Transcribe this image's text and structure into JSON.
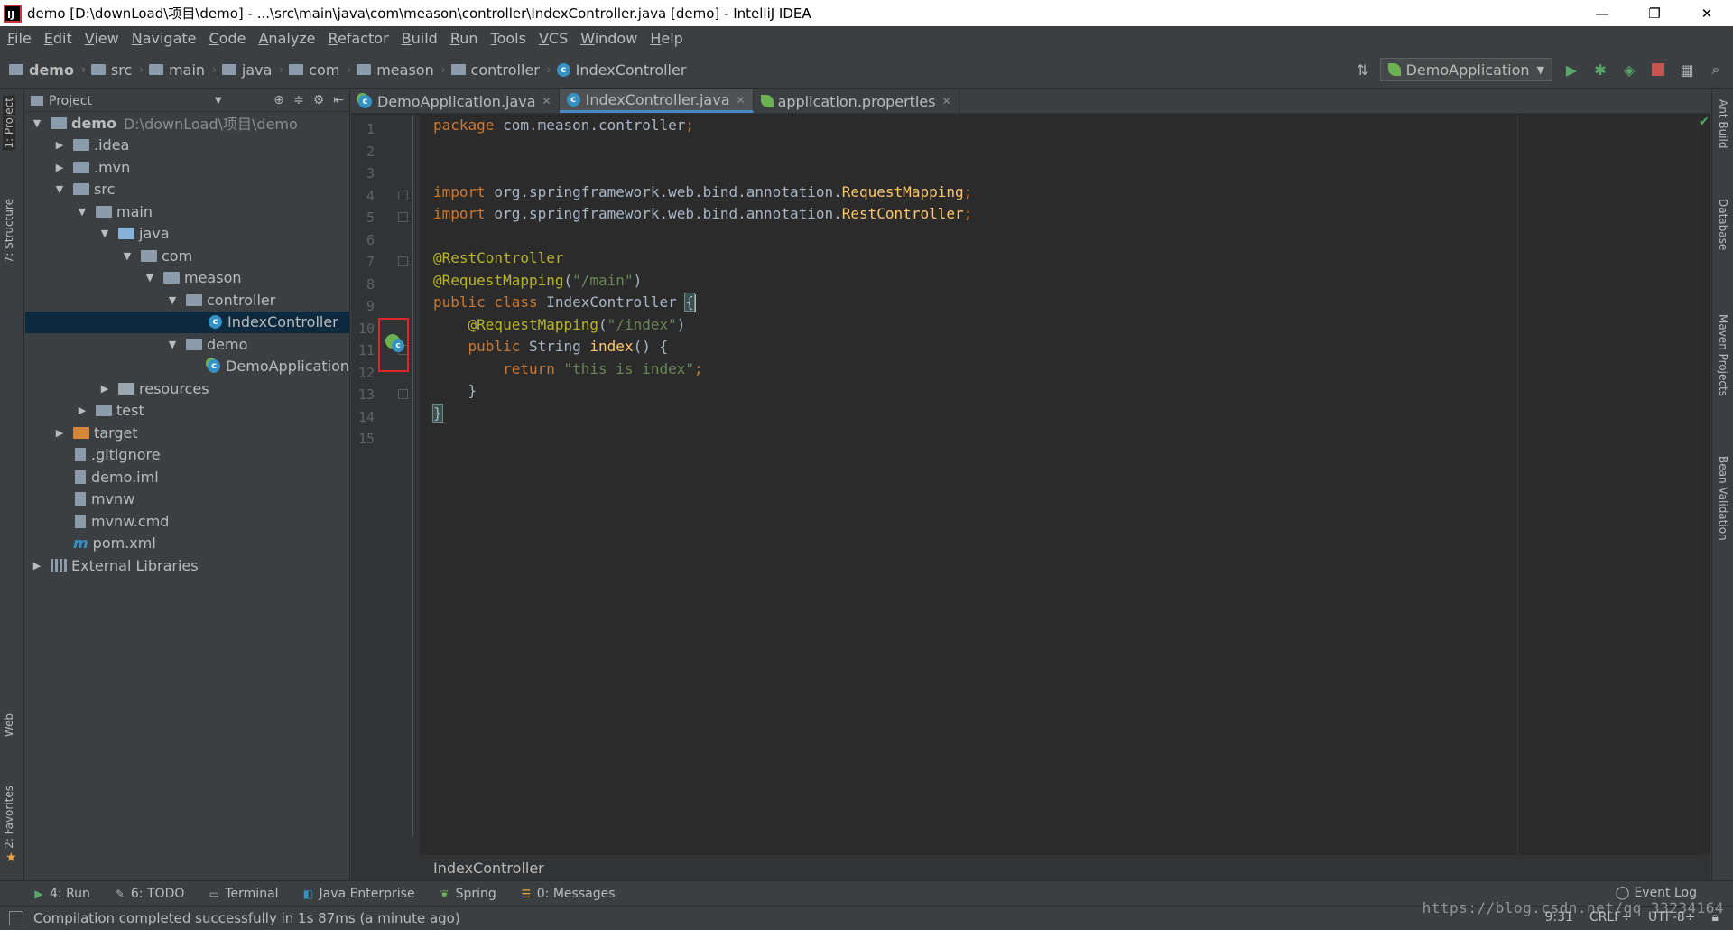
{
  "window": {
    "title": "demo [D:\\downLoad\\项目\\demo] - ...\\src\\main\\java\\com\\meason\\controller\\IndexController.java [demo] - IntelliJ IDEA",
    "app_icon_text": "IJ",
    "minimize": "—",
    "restore": "❐",
    "close": "✕"
  },
  "menu": [
    "File",
    "Edit",
    "View",
    "Navigate",
    "Code",
    "Analyze",
    "Refactor",
    "Build",
    "Run",
    "Tools",
    "VCS",
    "Window",
    "Help"
  ],
  "navbar": {
    "crumbs": [
      "demo",
      "src",
      "main",
      "java",
      "com",
      "meason",
      "controller",
      "IndexController"
    ],
    "run_config": "DemoApplication"
  },
  "left_tabs": {
    "project": "1: Project",
    "structure": "7: Structure",
    "web": "Web",
    "favorites": "2: Favorites"
  },
  "right_tabs": {
    "ant": "Ant Build",
    "database": "Database",
    "maven": "Maven Projects",
    "bean": "Bean Validation"
  },
  "project_panel": {
    "title": "Project",
    "tree": [
      {
        "label": "demo",
        "path": "D:\\downLoad\\项目\\demo",
        "indent": 0,
        "arrow": "▼",
        "kind": "folder"
      },
      {
        "label": ".idea",
        "indent": 1,
        "arrow": "▶",
        "kind": "folder"
      },
      {
        "label": ".mvn",
        "indent": 1,
        "arrow": "▶",
        "kind": "folder"
      },
      {
        "label": "src",
        "indent": 1,
        "arrow": "▼",
        "kind": "folder"
      },
      {
        "label": "main",
        "indent": 2,
        "arrow": "▼",
        "kind": "folder"
      },
      {
        "label": "java",
        "indent": 3,
        "arrow": "▼",
        "kind": "src"
      },
      {
        "label": "com",
        "indent": 4,
        "arrow": "▼",
        "kind": "folder"
      },
      {
        "label": "meason",
        "indent": 5,
        "arrow": "▼",
        "kind": "folder"
      },
      {
        "label": "controller",
        "indent": 6,
        "arrow": "▼",
        "kind": "folder"
      },
      {
        "label": "IndexController",
        "indent": 7,
        "arrow": "",
        "kind": "class"
      },
      {
        "label": "demo",
        "indent": 6,
        "arrow": "▼",
        "kind": "folder"
      },
      {
        "label": "DemoApplication",
        "indent": 7,
        "arrow": "",
        "kind": "springclass"
      },
      {
        "label": "resources",
        "indent": 3,
        "arrow": "▶",
        "kind": "res"
      },
      {
        "label": "test",
        "indent": 2,
        "arrow": "▶",
        "kind": "folder"
      },
      {
        "label": "target",
        "indent": 1,
        "arrow": "▶",
        "kind": "target"
      },
      {
        "label": ".gitignore",
        "indent": 1,
        "arrow": "",
        "kind": "file"
      },
      {
        "label": "demo.iml",
        "indent": 1,
        "arrow": "",
        "kind": "file"
      },
      {
        "label": "mvnw",
        "indent": 1,
        "arrow": "",
        "kind": "file"
      },
      {
        "label": "mvnw.cmd",
        "indent": 1,
        "arrow": "",
        "kind": "file"
      },
      {
        "label": "pom.xml",
        "indent": 1,
        "arrow": "",
        "kind": "maven"
      },
      {
        "label": "External Libraries",
        "indent": 0,
        "arrow": "▶",
        "kind": "libs"
      }
    ]
  },
  "tabs": [
    {
      "label": "DemoApplication.java",
      "kind": "springclass",
      "active": false
    },
    {
      "label": "IndexController.java",
      "kind": "class",
      "active": true
    },
    {
      "label": "application.properties",
      "kind": "props",
      "active": false
    }
  ],
  "editor": {
    "line_numbers": [
      "1",
      "2",
      "3",
      "4",
      "5",
      "6",
      "7",
      "8",
      "9",
      "10",
      "11",
      "12",
      "13",
      "14",
      "15"
    ],
    "code": {
      "l1_kw": "package",
      "l1_rest": " com.meason.controller",
      "semi": ";",
      "import_kw": "import",
      "l4_pkg": " org.springframework.web.bind.annotation.",
      "l4_cls": "RequestMapping",
      "l5_pkg": " org.springframework.web.bind.annotation.",
      "l5_cls": "RestController",
      "l7_ann": "@RestController",
      "l8_ann": "@RequestMapping",
      "l8_open": "(",
      "l8_str": "\"/main\"",
      "l8_close": ")",
      "l9_kw": "public class",
      "l9_name": " IndexController ",
      "l9_brace": "{",
      "l10_ann": "@RequestMapping",
      "l10_open": "(",
      "l10_str": "\"/index\"",
      "l10_close": ")",
      "l11_kw": "public",
      "l11_type": " String ",
      "l11_name": "index",
      "l11_rest": "() {",
      "l12_kw": "return",
      "l12_str": " \"this is index\"",
      "l13_brace": "}",
      "l14_brace": "}"
    },
    "breadcrumb": "IndexController"
  },
  "tool_windows": [
    {
      "label": "4: Run",
      "icon": "▶",
      "color": "#59a869"
    },
    {
      "label": "6: TODO",
      "icon": "✎",
      "color": "#afb1b3"
    },
    {
      "label": "Terminal",
      "icon": "▭",
      "color": "#afb1b3"
    },
    {
      "label": "Java Enterprise",
      "icon": "◧",
      "color": "#3592c4"
    },
    {
      "label": "Spring",
      "icon": "❦",
      "color": "#6cb252"
    },
    {
      "label": "0: Messages",
      "icon": "☰",
      "color": "#e8a33d"
    }
  ],
  "event_log": "Event Log",
  "status": {
    "message": "Compilation completed successfully in 1s 87ms (a minute ago)",
    "position": "9:31",
    "line_sep": "CRLF÷",
    "encoding": "UTF-8÷"
  },
  "watermark": "https://blog.csdn.net/qq_33234164",
  "colors": {
    "background": "#2b2b2b",
    "keyword": "#cc7832",
    "annotation": "#bbb529",
    "string": "#6a8759",
    "accent": "#4a88c7",
    "highlight_box": "#e0262a"
  }
}
